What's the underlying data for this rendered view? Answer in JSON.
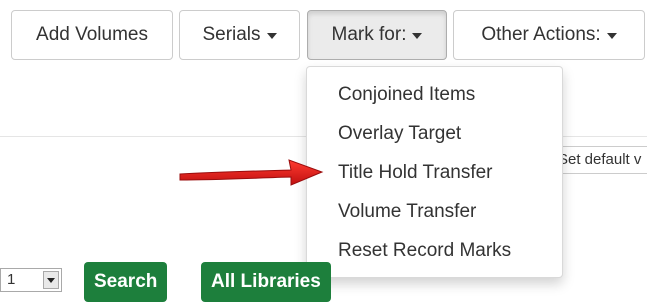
{
  "toolbar": {
    "add_volumes": "Add Volumes",
    "serials": "Serials",
    "mark_for": "Mark for:",
    "other_actions": "Other Actions:"
  },
  "mark_for_menu": {
    "items": [
      "Conjoined Items",
      "Overlay Target",
      "Title Hold Transfer",
      "Volume Transfer",
      "Reset Record Marks"
    ],
    "highlighted_item": "Title Hold Transfer"
  },
  "set_default": {
    "label": "Set default v"
  },
  "search_bar": {
    "select_value": "1",
    "search_label": "Search",
    "all_libraries_label": "All Libraries"
  },
  "colors": {
    "annotation_arrow": "#e02020",
    "green_button": "#1d7f3c"
  },
  "icons": {
    "caret": "chevron-down-icon",
    "annotation": "red-arrow-icon"
  }
}
